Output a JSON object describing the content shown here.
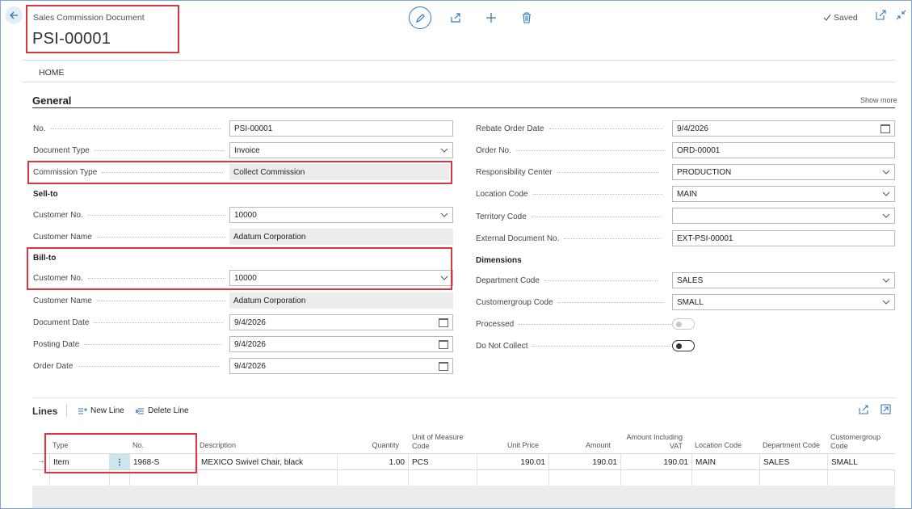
{
  "header": {
    "caption": "Sales Commission Document",
    "title": "PSI-00001",
    "saved": "Saved",
    "tab_home": "HOME"
  },
  "general": {
    "title": "General",
    "show_more": "Show more",
    "left": {
      "no_label": "No.",
      "no_value": "PSI-00001",
      "doctype_label": "Document Type",
      "doctype_value": "Invoice",
      "commtype_label": "Commission Type",
      "commtype_value": "Collect Commission",
      "sellto_head": "Sell-to",
      "sell_custno_label": "Customer No.",
      "sell_custno_value": "10000",
      "sell_custname_label": "Customer Name",
      "sell_custname_value": "Adatum Corporation",
      "billto_head": "Bill-to",
      "bill_custno_label": "Customer No.",
      "bill_custno_value": "10000",
      "bill_custname_label": "Customer Name",
      "bill_custname_value": "Adatum Corporation",
      "docdate_label": "Document Date",
      "docdate_value": "9/4/2026",
      "postdate_label": "Posting Date",
      "postdate_value": "9/4/2026",
      "orderdate_label": "Order Date",
      "orderdate_value": "9/4/2026"
    },
    "right": {
      "rebate_label": "Rebate Order Date",
      "rebate_value": "9/4/2026",
      "orderno_label": "Order No.",
      "orderno_value": "ORD-00001",
      "resp_label": "Responsibility Center",
      "resp_value": "PRODUCTION",
      "loc_label": "Location Code",
      "loc_value": "MAIN",
      "terr_label": "Territory Code",
      "terr_value": "",
      "extdoc_label": "External Document No.",
      "extdoc_value": "EXT-PSI-00001",
      "dims_head": "Dimensions",
      "dept_label": "Department Code",
      "dept_value": "SALES",
      "custgrp_label": "Customergroup Code",
      "custgrp_value": "SMALL",
      "processed_label": "Processed",
      "processed_value": false,
      "donotcollect_label": "Do Not Collect",
      "donotcollect_value": false
    }
  },
  "lines": {
    "title": "Lines",
    "new_line": "New Line",
    "delete_line": "Delete Line",
    "columns": {
      "type": "Type",
      "no": "No.",
      "description": "Description",
      "quantity": "Quantity",
      "uom_1": "Unit of Measure",
      "uom_2": "Code",
      "unit_price": "Unit Price",
      "amount": "Amount",
      "amt_vat_1": "Amount Including",
      "amt_vat_2": "VAT",
      "location": "Location Code",
      "department": "Department Code",
      "custgrp_1": "Customergroup",
      "custgrp_2": "Code"
    },
    "rows": [
      {
        "type": "Item",
        "no": "1968-S",
        "description": "MEXICO Swivel Chair, black",
        "quantity": "1.00",
        "uom": "PCS",
        "unit_price": "190.01",
        "amount": "190.01",
        "amount_incl_vat": "190.01",
        "location": "MAIN",
        "department": "SALES",
        "custgrp": "SMALL"
      }
    ]
  },
  "colors": {
    "accent": "#2f79b7",
    "highlight": "#d9363e",
    "readonly_bg": "#ececec"
  }
}
